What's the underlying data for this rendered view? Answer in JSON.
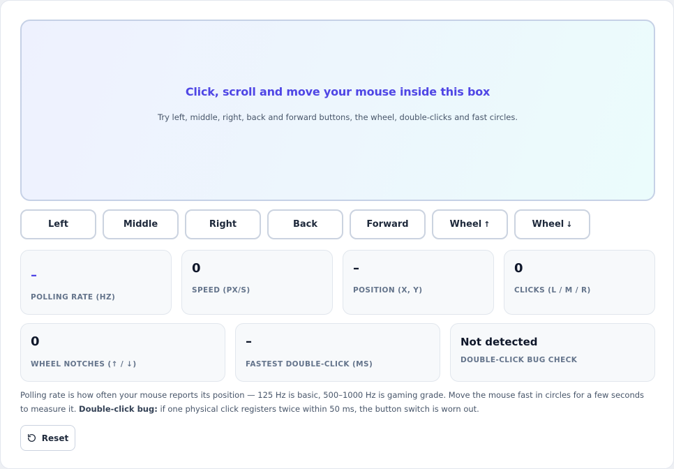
{
  "test_area": {
    "title": "Click, scroll and move your mouse inside this box",
    "subtitle": "Try left, middle, right, back and forward buttons, the wheel, double-clicks and fast circles."
  },
  "buttons": [
    {
      "label": "Left"
    },
    {
      "label": "Middle"
    },
    {
      "label": "Right"
    },
    {
      "label": "Back"
    },
    {
      "label": "Forward"
    },
    {
      "label": "Wheel",
      "arrow": "↑"
    },
    {
      "label": "Wheel",
      "arrow": "↓"
    }
  ],
  "stats": {
    "polling_rate": {
      "value": "–",
      "label": "Polling rate (Hz)"
    },
    "speed": {
      "value": "0",
      "label": "Speed (px/s)"
    },
    "position": {
      "value": "–",
      "label": "Position (x, y)"
    },
    "clicks": {
      "value": "0",
      "label": "Clicks (L / M / R)"
    },
    "wheel_notches": {
      "value": "0",
      "label": "Wheel notches (↑ / ↓)"
    },
    "fastest_double_click": {
      "value": "–",
      "label": "Fastest double-click (ms)"
    },
    "double_click_bug": {
      "value": "Not detected",
      "label": "Double-click bug check"
    }
  },
  "note": {
    "part1": "Polling rate is how often your mouse reports its position — 125 Hz is basic, 500–1000 Hz is gaming grade. Move the mouse fast in circles for a few seconds to measure it. ",
    "bold": "Double-click bug:",
    "part2": " if one physical click registers twice within 50 ms, the button switch is worn out."
  },
  "reset": {
    "label": "Reset",
    "icon": "rotate-ccw-icon"
  },
  "colors": {
    "accent": "#4f46e5",
    "text": "#1e293b",
    "muted": "#64748b"
  }
}
